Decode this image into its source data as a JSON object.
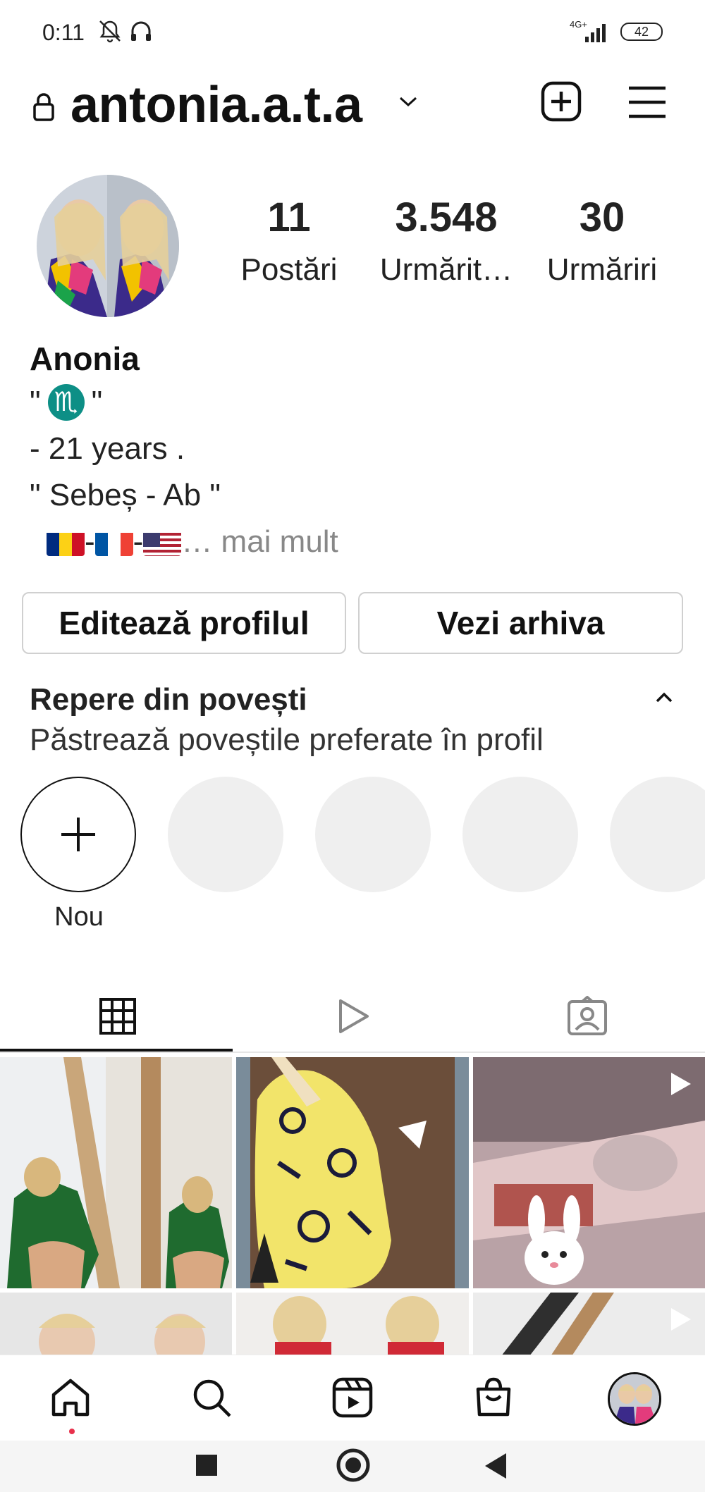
{
  "status_bar": {
    "time": "0:11",
    "network": "4G+",
    "battery": "42"
  },
  "header": {
    "username": "antonia.a.t.a"
  },
  "stats": [
    {
      "value": "11",
      "label": "Postări"
    },
    {
      "value": "3.548",
      "label": "Urmărit…"
    },
    {
      "value": "30",
      "label": "Urmăriri"
    }
  ],
  "bio": {
    "name": "Anonia",
    "line1_open": "\"",
    "line1_close": "\"",
    "zodiac_glyph": "♏",
    "line2": "- 21 years .",
    "line3": "\" Sebeș - Ab \"",
    "flags_sep": "-",
    "more_label": "… mai mult"
  },
  "buttons": {
    "edit_profile": "Editează profilul",
    "view_archive": "Vezi arhiva"
  },
  "highlights": {
    "title": "Repere din povești",
    "subtitle": "Păstrează poveștile preferate în profil",
    "new_label": "Nou"
  },
  "colors": {
    "accent_dot": "#e8304b",
    "zodiac_bg": "#0d8f86"
  }
}
